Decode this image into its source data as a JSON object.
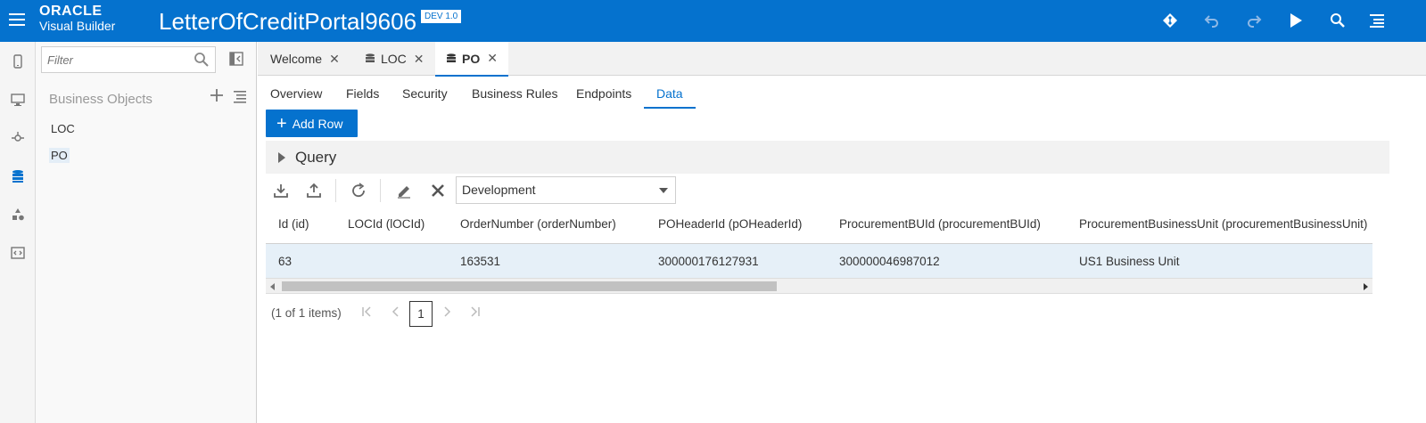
{
  "header": {
    "brand_line1": "ORACLE",
    "brand_line2": "Visual Builder",
    "app_title": "LetterOfCreditPortal9606",
    "version_badge": "DEV 1.0",
    "accent_color": "#0572ce",
    "icons": [
      "menu-icon",
      "git-icon",
      "undo-icon",
      "redo-icon",
      "run-icon",
      "search-icon",
      "more-menu-icon"
    ]
  },
  "rail": {
    "items": [
      "mobile-apps-icon",
      "web-apps-icon",
      "services-icon",
      "business-objects-icon",
      "components-icon",
      "source-view-icon"
    ],
    "active": "business-objects-icon"
  },
  "navigator": {
    "filter_placeholder": "Filter",
    "section_title": "Business Objects",
    "items": [
      {
        "label": "LOC"
      },
      {
        "label": "PO"
      }
    ],
    "selected": "PO"
  },
  "doc_tabs": [
    {
      "label": "Welcome"
    },
    {
      "label": "LOC"
    },
    {
      "label": "PO"
    }
  ],
  "sub_tabs": [
    "Overview",
    "Fields",
    "Security",
    "Business Rules",
    "Endpoints",
    "Data"
  ],
  "active_sub_tab": "Data",
  "actions": {
    "add_row_label": "Add Row",
    "query_label": "Query",
    "environment": "Development"
  },
  "table": {
    "columns": [
      "Id (id)",
      "LOCId (lOCId)",
      "OrderNumber (orderNumber)",
      "POHeaderId (pOHeaderId)",
      "ProcurementBUId (procurementBUId)",
      "ProcurementBusinessUnit (procurementBusinessUnit)"
    ],
    "rows": [
      [
        "63",
        "",
        "163531",
        "300000176127931",
        "300000046987012",
        "US1 Business Unit"
      ]
    ]
  },
  "pager": {
    "info": "(1 of 1 items)",
    "current_page": "1"
  }
}
